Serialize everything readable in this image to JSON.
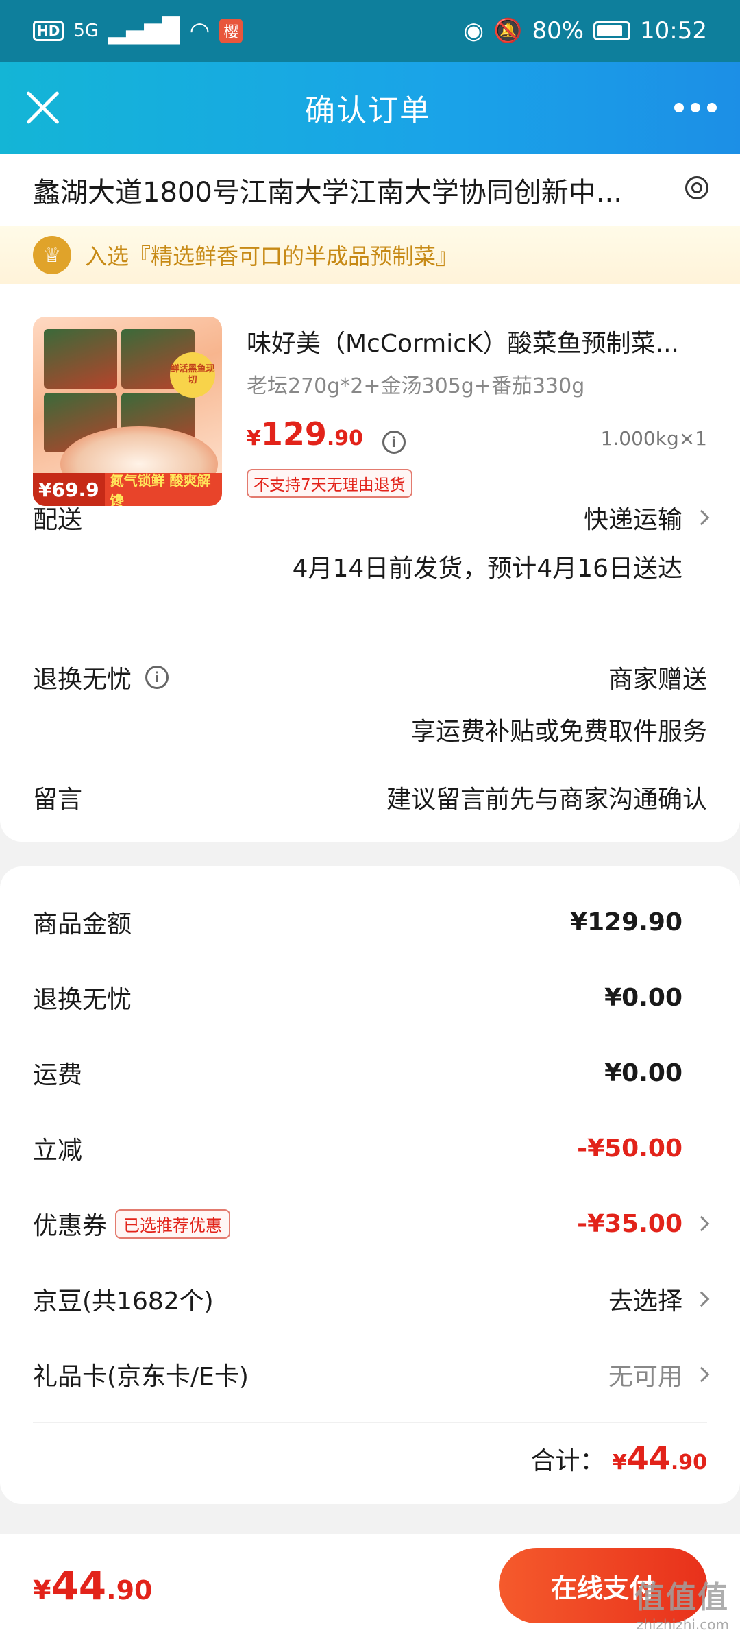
{
  "status_bar": {
    "hd": "HD",
    "network": "5G",
    "app_badge": "樱",
    "battery": "80%",
    "time": "10:52"
  },
  "header": {
    "title": "确认订单"
  },
  "address": {
    "text": "蠡湖大道1800号江南大学江南大学协同创新中..."
  },
  "banner": {
    "text": "入选『精选鲜香可口的半成品预制菜』"
  },
  "product": {
    "title": "味好美（McCormicK）酸菜鱼预制菜...",
    "spec": "老坛270g*2+金汤305g+番茄330g",
    "price_currency": "¥",
    "price_int": "129",
    "price_dec": ".90",
    "quantity": "1.000kg×1",
    "no_return": "不支持7天无理由退货",
    "thumb_badge": "鲜活黑鱼现切",
    "thumb_price": "¥69.9",
    "thumb_slogan": "氮气锁鲜 酸爽解馋"
  },
  "delivery": {
    "label": "配送",
    "method": "快递运输",
    "eta": "4月14日前发货，预计4月16日送达"
  },
  "worry_free": {
    "label": "退换无忧",
    "value": "商家赠送",
    "sub": "享运费补贴或免费取件服务"
  },
  "message": {
    "label": "留言",
    "placeholder": "建议留言前先与商家沟通确认"
  },
  "summary": {
    "goods_label": "商品金额",
    "goods_value": "¥129.90",
    "worry_label": "退换无忧",
    "worry_value": "¥0.00",
    "shipping_label": "运费",
    "shipping_value": "¥0.00",
    "discount_label": "立减",
    "discount_value": "-¥50.00",
    "coupon_label": "优惠券",
    "coupon_badge": "已选推荐优惠",
    "coupon_value": "-¥35.00",
    "jd_beans_label": "京豆(共1682个)",
    "jd_beans_value": "去选择",
    "gift_card_label": "礼品卡(京东卡/E卡)",
    "gift_card_value": "无可用",
    "total_label": "合计：",
    "total_currency": "¥",
    "total_int": "44",
    "total_dec": ".90"
  },
  "bottom": {
    "currency": "¥",
    "price_int": "44",
    "price_dec": ".90",
    "pay_label": "在线支付"
  },
  "watermark": {
    "logo": "值值值",
    "url": "zhizhizhi.com"
  },
  "colors": {
    "accent_red": "#e2231a",
    "header_blue": "#1aa3e8"
  }
}
